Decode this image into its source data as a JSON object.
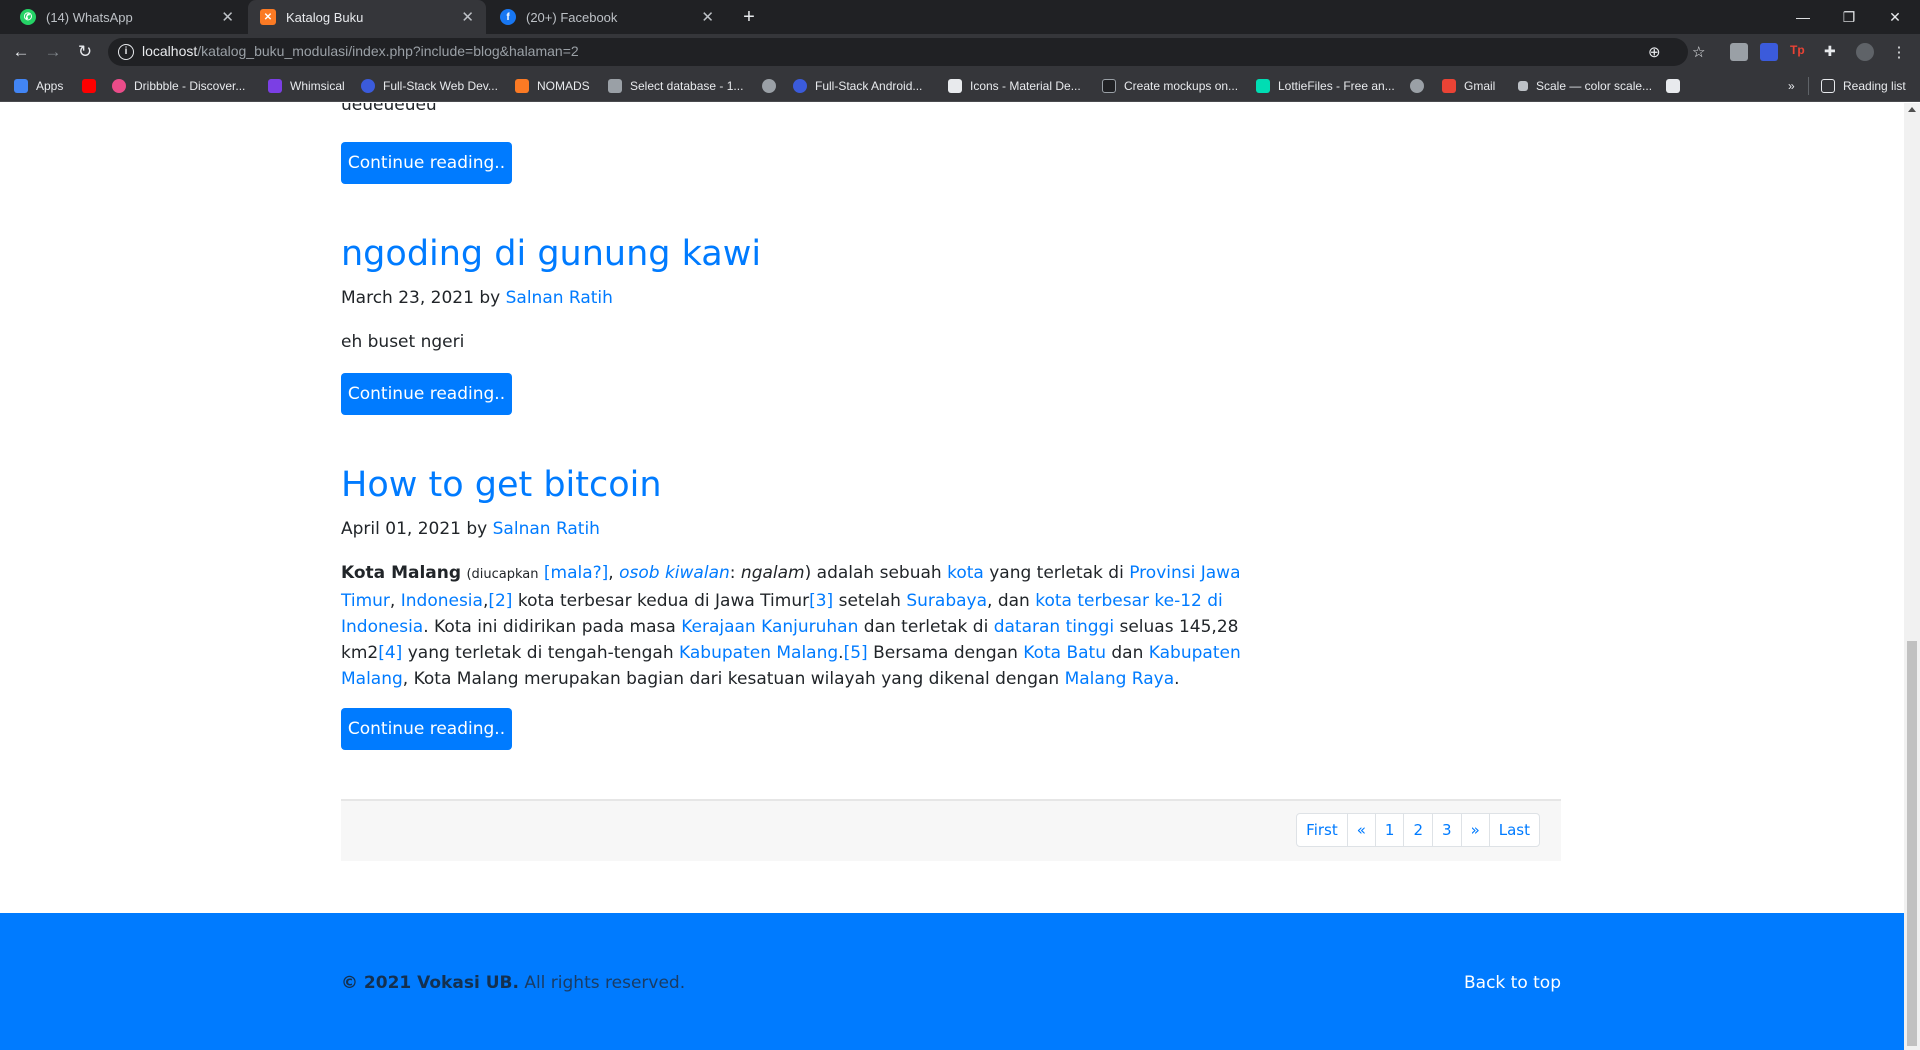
{
  "browser": {
    "tabs": [
      {
        "title": "(14) WhatsApp",
        "icon": "whatsapp-icon",
        "color": "#25d366"
      },
      {
        "title": "Katalog Buku",
        "icon": "xampp-icon",
        "color": "#fb7a24"
      },
      {
        "title": "(20+) Facebook",
        "icon": "facebook-icon",
        "color": "#1877f2"
      }
    ],
    "url_host": "localhost",
    "url_path": "/katalog_buku_modulasi/index.php?include=blog&halaman=2",
    "bookmarks": [
      {
        "label": "Apps",
        "color": "#4285f4"
      },
      {
        "label": "",
        "color": "#ff0000"
      },
      {
        "label": "Dribbble - Discover...",
        "color": "#ea4c89"
      },
      {
        "label": "Whimsical",
        "color": "#7b3fe4"
      },
      {
        "label": "Full-Stack Web Dev...",
        "color": "#3b5bdb"
      },
      {
        "label": "NOMADS",
        "color": "#fb7a24"
      },
      {
        "label": "Select database - 1...",
        "color": "#9aa0a6"
      },
      {
        "label": "",
        "color": "#9aa0a6"
      },
      {
        "label": "Full-Stack Android...",
        "color": "#3b5bdb"
      },
      {
        "label": "Icons - Material De...",
        "color": "#e8eaed"
      },
      {
        "label": "Create mockups on...",
        "color": "#202124"
      },
      {
        "label": "LottieFiles - Free an...",
        "color": "#00ddb3"
      },
      {
        "label": "",
        "color": "#9aa0a6"
      },
      {
        "label": "Gmail",
        "color": "#ea4335"
      },
      {
        "label": "Scale — color scale...",
        "color": "#bdc1c6"
      },
      {
        "label": "",
        "color": "#e8eaed"
      }
    ],
    "reading_list": "Reading list",
    "overflow": "»"
  },
  "page": {
    "trailing_text": "ueueueueu",
    "continue_label": "Continue reading..",
    "posts": [
      {
        "title": "ngoding di gunung kawi",
        "date": "March 23, 2021",
        "by": "by",
        "author": "Salnan Ratih",
        "excerpt": "eh buset ngeri"
      },
      {
        "title": "How to get bitcoin",
        "date": "April 01, 2021",
        "by": "by",
        "author": "Salnan Ratih"
      }
    ],
    "article": {
      "bold_name": "Kota Malang",
      "pron_prefix": "(diucapkan",
      "pron_link": "[mala?]",
      "comma": ",",
      "osob": "osob kiwalan",
      "colon": ":",
      "ngalam": "ngalam",
      "close_paren": ")",
      "t1": "adalah sebuah",
      "l_kota": "kota",
      "t2": "yang terletak di",
      "l_provinsi": "Provinsi Jawa Timur",
      "l_indonesia": "Indonesia",
      "ref2": "[2]",
      "t3": "kota terbesar kedua di Jawa Timur",
      "ref3": "[3]",
      "t4": "setelah",
      "l_surabaya": "Surabaya",
      "t5": ", dan",
      "l_terbesar": "kota terbesar ke-12 di Indonesia",
      "t6": ". Kota ini didirikan pada masa",
      "l_kanjuruhan": "Kerajaan Kanjuruhan",
      "t7": "dan terletak di",
      "l_dataran": "dataran tinggi",
      "t8": "seluas 145,28 km2",
      "ref4": "[4]",
      "t9": "yang terletak di tengah-tengah",
      "l_kabmalang": "Kabupaten Malang",
      "ref5": "[5]",
      "t10": "Bersama dengan",
      "l_kotabatu": "Kota Batu",
      "t11": "dan",
      "l_kabmalang2": "Kabupaten Malang",
      "t12": ", Kota Malang merupakan bagian dari kesatuan wilayah yang dikenal dengan",
      "l_malangraya": "Malang Raya",
      "t13": "."
    },
    "pagination": [
      "First",
      "«",
      "1",
      "2",
      "3",
      "»",
      "Last"
    ],
    "footer": {
      "copyright_bold": "© 2021 Vokasi UB.",
      "copyright_rest": "All rights reserved.",
      "back_to_top": "Back to top"
    }
  },
  "colors": {
    "primary": "#007bff",
    "chrome_dark": "#202124",
    "chrome_toolbar": "#35363a"
  }
}
